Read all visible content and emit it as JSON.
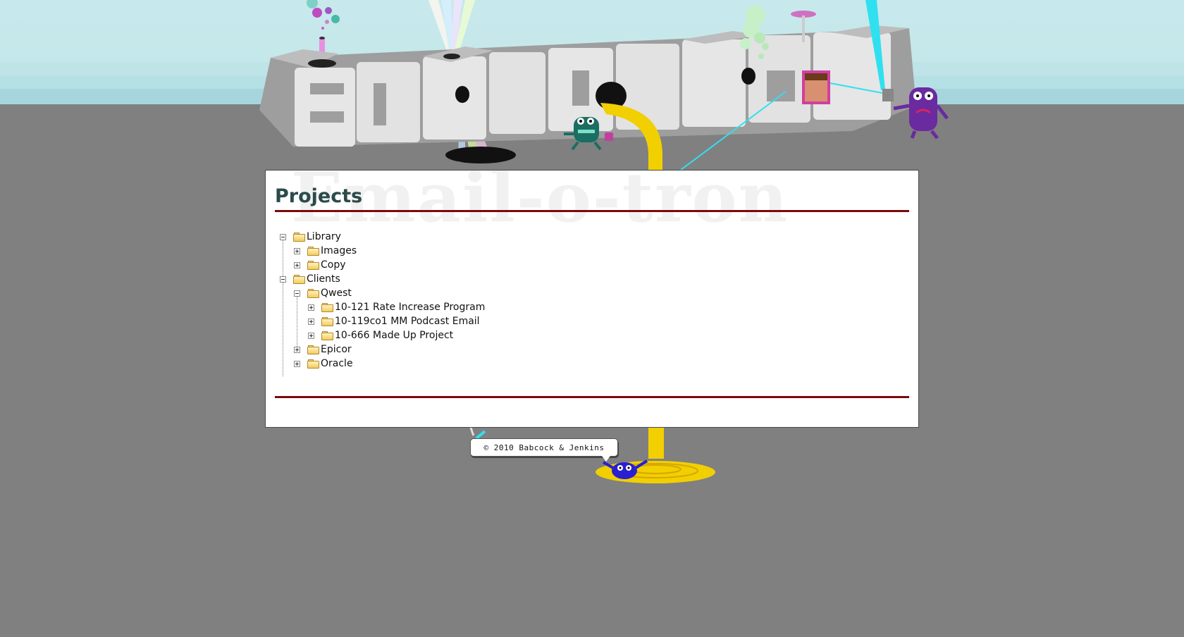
{
  "header": {
    "logo_text": "EMAIL-O-TRON"
  },
  "panel": {
    "watermark": "Email-o-tron",
    "title": "Projects"
  },
  "tree": {
    "library": {
      "label": "Library",
      "state": "expanded"
    },
    "images": {
      "label": "Images",
      "state": "collapsed"
    },
    "copy": {
      "label": "Copy",
      "state": "collapsed"
    },
    "clients": {
      "label": "Clients",
      "state": "expanded"
    },
    "qwest": {
      "label": "Qwest",
      "state": "expanded"
    },
    "p1": {
      "label": "10-121 Rate Increase Program",
      "state": "collapsed"
    },
    "p2": {
      "label": "10-119co1 MM Podcast Email",
      "state": "collapsed"
    },
    "p3": {
      "label": "10-666 Made Up Project",
      "state": "collapsed"
    },
    "epicor": {
      "label": "Epicor",
      "state": "collapsed"
    },
    "oracle": {
      "label": "Oracle",
      "state": "collapsed"
    }
  },
  "footer": {
    "copyright": "© 2010 Babcock & Jenkins"
  },
  "colors": {
    "background": "#808080",
    "sky": "#c4e7ea",
    "title": "#2b4a4c",
    "rule": "#7a0a0a",
    "stream": "#f2cf00"
  },
  "icons": [
    "folder-icon",
    "expand-icon",
    "collapse-icon"
  ]
}
